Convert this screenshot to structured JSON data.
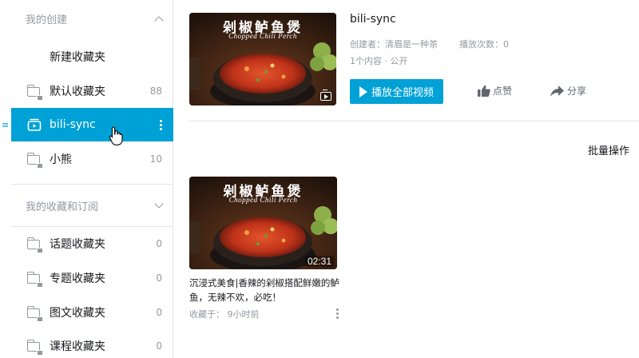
{
  "sidebar": {
    "my_created": {
      "header": "我的创建"
    },
    "items": [
      {
        "label": "新建收藏夹",
        "count": ""
      },
      {
        "label": "默认收藏夹",
        "count": "88"
      },
      {
        "label": "bili-sync",
        "count": ""
      },
      {
        "label": "小熊",
        "count": "10"
      }
    ],
    "subscribed": {
      "header": "我的收藏和订阅",
      "items": [
        {
          "label": "话题收藏夹",
          "count": "0"
        },
        {
          "label": "专题收藏夹",
          "count": "0"
        },
        {
          "label": "图文收藏夹",
          "count": "0"
        },
        {
          "label": "课程收藏夹",
          "count": "0"
        }
      ]
    }
  },
  "folder_info": {
    "title": "bili-sync",
    "creator": "创建者：清眉是一种茶",
    "plays": "播放次数：0",
    "count_visibility": "1个内容 · 公开",
    "play_all_label": "播放全部视频",
    "like_label": "点赞",
    "share_label": "分享"
  },
  "cover": {
    "title_text": "剁椒鲈鱼煲",
    "subtitle_text": "Chopped Chili Perch"
  },
  "toolbar": {
    "batch_label": "批量操作"
  },
  "video": {
    "title": "沉浸式美食|香辣的剁椒搭配鲜嫩的鲈鱼，无辣不欢，必吃！",
    "duration": "02:31",
    "saved_time": "收藏于：  9小时前"
  },
  "colors": {
    "accent": "#00a1d6",
    "muted": "#9499a0",
    "text": "#18191c"
  }
}
